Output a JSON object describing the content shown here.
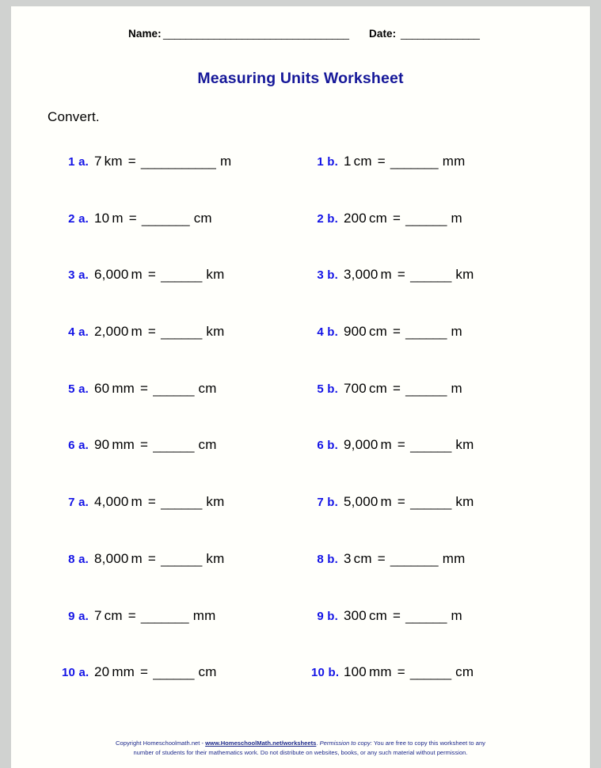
{
  "page": {
    "background_color": "#fffffb",
    "surround_color": "#d0d2d0"
  },
  "header": {
    "name_label": "Name:",
    "name_blank": "_________________________________",
    "date_label": "Date:",
    "date_blank": "______________"
  },
  "title": "Measuring Units Worksheet",
  "title_color": "#161899",
  "instruction": "Convert.",
  "number_color": "#1414e6",
  "problems": [
    {
      "a": {
        "num": "1 a.",
        "value": "7",
        "unit": "km",
        "eq": "=",
        "blank": "___________",
        "result_unit": "m"
      },
      "b": {
        "num": "1 b.",
        "value": "1",
        "unit": "cm",
        "eq": "=",
        "blank": "_______",
        "result_unit": "mm"
      }
    },
    {
      "a": {
        "num": "2 a.",
        "value": "10",
        "unit": "m",
        "eq": "=",
        "blank": "_______",
        "result_unit": "cm"
      },
      "b": {
        "num": "2 b.",
        "value": "200",
        "unit": "cm",
        "eq": "=",
        "blank": "______",
        "result_unit": "m"
      }
    },
    {
      "a": {
        "num": "3 a.",
        "value": "6,000",
        "unit": "m",
        "eq": "=",
        "blank": "______",
        "result_unit": "km"
      },
      "b": {
        "num": "3 b.",
        "value": "3,000",
        "unit": "m",
        "eq": "=",
        "blank": "______",
        "result_unit": "km"
      }
    },
    {
      "a": {
        "num": "4 a.",
        "value": "2,000",
        "unit": "m",
        "eq": "=",
        "blank": "______",
        "result_unit": "km"
      },
      "b": {
        "num": "4 b.",
        "value": "900",
        "unit": "cm",
        "eq": "=",
        "blank": "______",
        "result_unit": "m"
      }
    },
    {
      "a": {
        "num": "5 a.",
        "value": "60",
        "unit": "mm",
        "eq": "=",
        "blank": "______",
        "result_unit": "cm"
      },
      "b": {
        "num": "5 b.",
        "value": "700",
        "unit": "cm",
        "eq": "=",
        "blank": "______",
        "result_unit": "m"
      }
    },
    {
      "a": {
        "num": "6 a.",
        "value": "90",
        "unit": "mm",
        "eq": "=",
        "blank": "______",
        "result_unit": "cm"
      },
      "b": {
        "num": "6 b.",
        "value": "9,000",
        "unit": "m",
        "eq": "=",
        "blank": "______",
        "result_unit": "km"
      }
    },
    {
      "a": {
        "num": "7 a.",
        "value": "4,000",
        "unit": "m",
        "eq": "=",
        "blank": "______",
        "result_unit": "km"
      },
      "b": {
        "num": "7 b.",
        "value": "5,000",
        "unit": "m",
        "eq": "=",
        "blank": "______",
        "result_unit": "km"
      }
    },
    {
      "a": {
        "num": "8 a.",
        "value": "8,000",
        "unit": "m",
        "eq": "=",
        "blank": "______",
        "result_unit": "km"
      },
      "b": {
        "num": "8 b.",
        "value": "3",
        "unit": "cm",
        "eq": "=",
        "blank": "_______",
        "result_unit": "mm"
      }
    },
    {
      "a": {
        "num": "9 a.",
        "value": "7",
        "unit": "cm",
        "eq": "=",
        "blank": "_______",
        "result_unit": "mm"
      },
      "b": {
        "num": "9 b.",
        "value": "300",
        "unit": "cm",
        "eq": "=",
        "blank": "______",
        "result_unit": "m"
      }
    },
    {
      "a": {
        "num": "10 a.",
        "value": "20",
        "unit": "mm",
        "eq": "=",
        "blank": "______",
        "result_unit": "cm"
      },
      "b": {
        "num": "10 b.",
        "value": "100",
        "unit": "mm",
        "eq": "=",
        "blank": "______",
        "result_unit": "cm"
      }
    }
  ],
  "footer": {
    "line1_pre": "Copyright Homeschoolmath.net - ",
    "link": "www.HomeschoolMath.net/worksheets",
    "line1_mid": ". ",
    "permission_italic": "Permission to copy:",
    "line1_post": " You are free to copy this worksheet to any",
    "line2": "number of students for their mathematics work. Do not distribute on websites, books, or any such material without permission.",
    "color": "#1e2a8c"
  }
}
